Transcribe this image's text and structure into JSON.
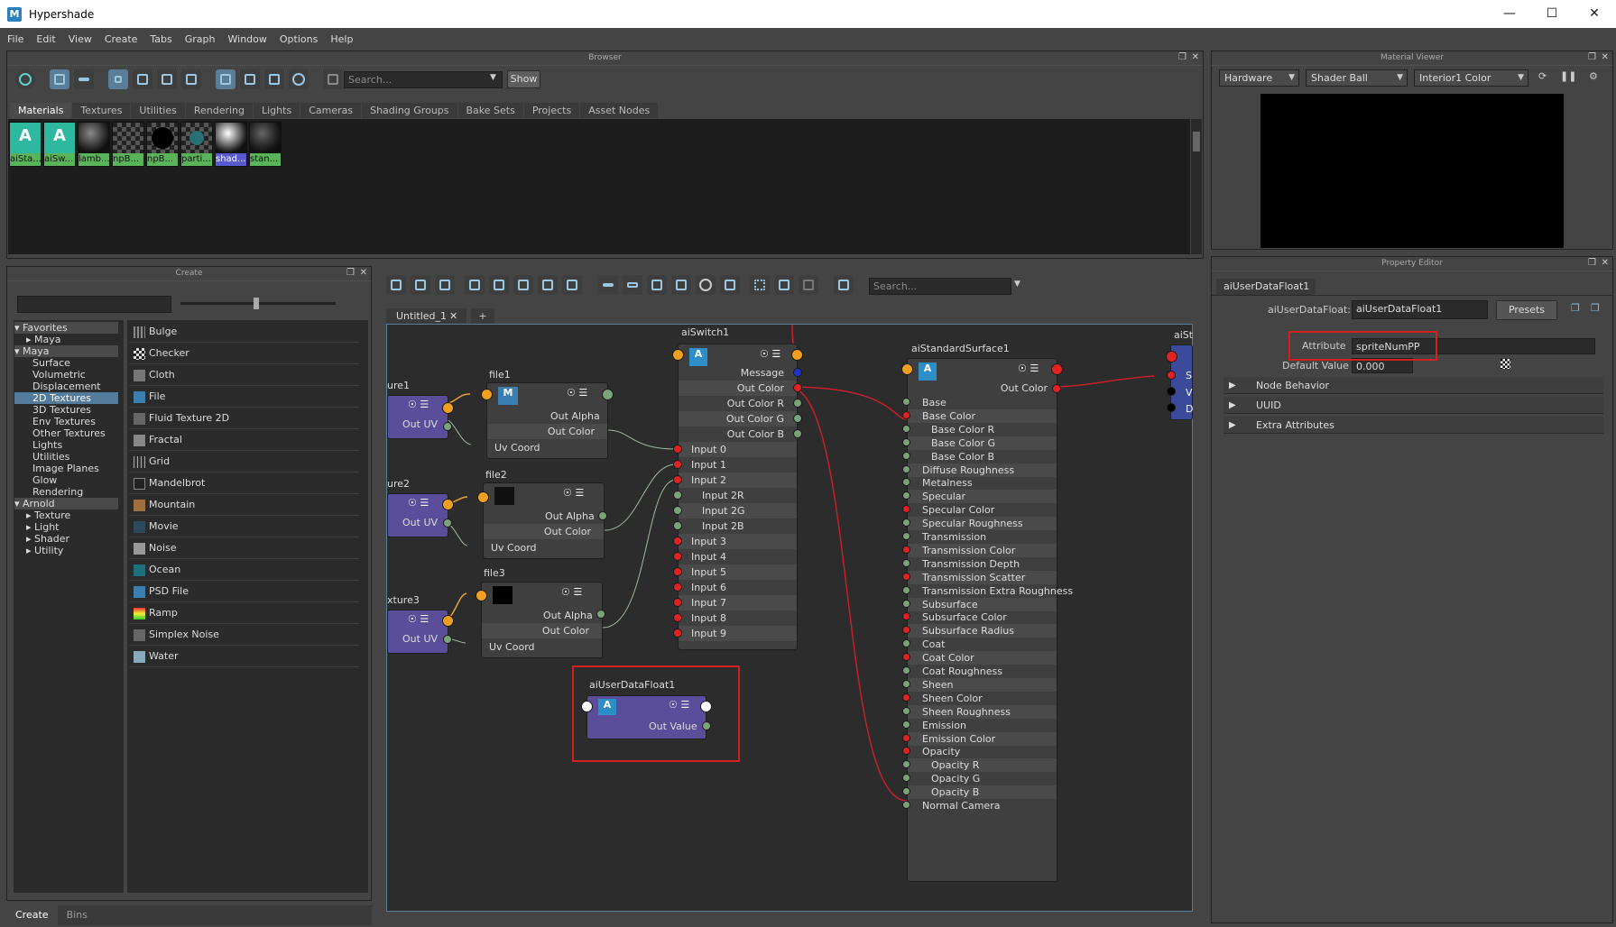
{
  "window": {
    "title": "Hypershade",
    "app_icon": "M"
  },
  "menubar": [
    "File",
    "Edit",
    "View",
    "Create",
    "Tabs",
    "Graph",
    "Window",
    "Options",
    "Help"
  ],
  "browser": {
    "header": "Browser",
    "search_placeholder": "Search...",
    "show_button": "Show",
    "tabs": [
      "Materials",
      "Textures",
      "Utilities",
      "Rendering",
      "Lights",
      "Cameras",
      "Shading Groups",
      "Bake Sets",
      "Projects",
      "Asset Nodes"
    ],
    "swatches": [
      "aiSta...",
      "aiSw...",
      "lamb...",
      "npB...",
      "npB...",
      "parti...",
      "shad...",
      "stan..."
    ]
  },
  "create_panel": {
    "header": "Create",
    "tree": [
      {
        "label": "Favorites",
        "kind": "group-open"
      },
      {
        "label": "Maya",
        "kind": "child-closed"
      },
      {
        "label": "Maya",
        "kind": "group-open"
      },
      {
        "label": "Surface",
        "kind": "leaf"
      },
      {
        "label": "Volumetric",
        "kind": "leaf"
      },
      {
        "label": "Displacement",
        "kind": "leaf"
      },
      {
        "label": "2D Textures",
        "kind": "leaf-selected"
      },
      {
        "label": "3D Textures",
        "kind": "leaf"
      },
      {
        "label": "Env Textures",
        "kind": "leaf"
      },
      {
        "label": "Other Textures",
        "kind": "leaf"
      },
      {
        "label": "Lights",
        "kind": "leaf"
      },
      {
        "label": "Utilities",
        "kind": "leaf"
      },
      {
        "label": "Image Planes",
        "kind": "leaf"
      },
      {
        "label": "Glow",
        "kind": "leaf"
      },
      {
        "label": "Rendering",
        "kind": "leaf"
      },
      {
        "label": "Arnold",
        "kind": "group-open"
      },
      {
        "label": "Texture",
        "kind": "child-closed"
      },
      {
        "label": "Light",
        "kind": "child-closed"
      },
      {
        "label": "Shader",
        "kind": "child-closed"
      },
      {
        "label": "Utility",
        "kind": "child-closed"
      }
    ],
    "nodes": [
      "Bulge",
      "Checker",
      "Cloth",
      "File",
      "Fluid Texture 2D",
      "Fractal",
      "Grid",
      "Mandelbrot",
      "Mountain",
      "Movie",
      "Noise",
      "Ocean",
      "PSD File",
      "Ramp",
      "Simplex Noise",
      "Water"
    ],
    "bottom_tabs": [
      "Create",
      "Bins"
    ]
  },
  "graph": {
    "search_placeholder": "Search...",
    "tab_name": "Untitled_1",
    "tab_add": "+",
    "place2d": [
      {
        "title": "ure1",
        "port": "Out UV"
      },
      {
        "title": "ure2",
        "port": "Out UV"
      },
      {
        "title": "xture3",
        "port": "Out UV"
      }
    ],
    "files": [
      {
        "title": "file1",
        "ports": [
          "Out Alpha",
          "Out Color",
          "Uv Coord"
        ]
      },
      {
        "title": "file2",
        "ports": [
          "Out Alpha",
          "Out Color",
          "Uv Coord"
        ]
      },
      {
        "title": "file3",
        "ports": [
          "Out Alpha",
          "Out Color",
          "Uv Coord"
        ]
      }
    ],
    "switch": {
      "title": "aiSwitch1",
      "attrs": [
        "Message",
        "Out Color",
        "Out Color R",
        "Out Color G",
        "Out Color B",
        "Input 0",
        "Input 1",
        "Input 2",
        "Input 2R",
        "Input 2G",
        "Input 2B",
        "Input 3",
        "Input 4",
        "Input 5",
        "Input 6",
        "Input 7",
        "Input 8",
        "Input 9"
      ]
    },
    "surface": {
      "title": "aiStandardSurface1",
      "out": "Out Color",
      "attrs": [
        "Base",
        "Base Color",
        "Base Color R",
        "Base Color G",
        "Base Color B",
        "Diffuse Roughness",
        "Metalness",
        "Specular",
        "Specular Color",
        "Specular Roughness",
        "Transmission",
        "Transmission Color",
        "Transmission Depth",
        "Transmission Scatter",
        "Transmission Extra Roughness",
        "Subsurface",
        "Subsurface Color",
        "Subsurface Radius",
        "Coat",
        "Coat Color",
        "Coat Roughness",
        "Sheen",
        "Sheen Color",
        "Sheen Roughness",
        "Emission",
        "Emission Color",
        "Opacity",
        "Opacity R",
        "Opacity G",
        "Opacity B",
        "Normal Camera"
      ]
    },
    "userdata": {
      "title": "aiUserDataFloat1",
      "port": "Out Value"
    },
    "sg": {
      "title": "aiSt",
      "ports": [
        "S",
        "V",
        "D"
      ]
    }
  },
  "material_viewer": {
    "header": "Material Viewer",
    "renderer": "Hardware",
    "geometry": "Shader Ball",
    "environment": "Interior1 Color"
  },
  "property_editor": {
    "header": "Property Editor",
    "tab": "aiUserDataFloat1",
    "node_label": "aiUserDataFloat:",
    "node_value": "aiUserDataFloat1",
    "presets": "Presets",
    "attribute_label": "Attribute",
    "attribute_value": "spriteNumPP",
    "default_label": "Default Value",
    "default_value": "0.000",
    "sections": [
      "Node Behavior",
      "UUID",
      "Extra Attributes"
    ]
  },
  "colors": {
    "selection": "#527b9c",
    "highlight_box": "#d02020",
    "connection": "#c8202a",
    "swatch_label": "#59b359"
  }
}
